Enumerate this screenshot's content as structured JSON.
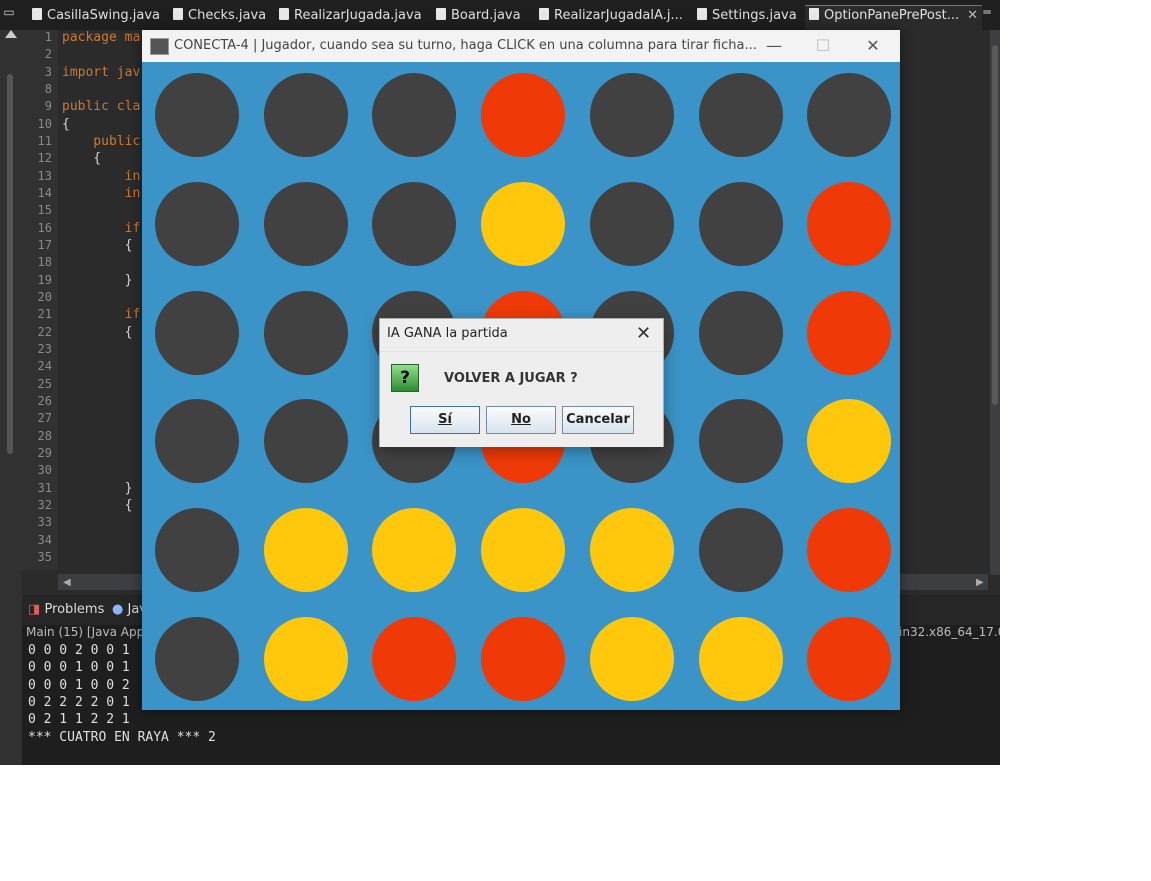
{
  "ide": {
    "editor_tabs": [
      {
        "label": "CasillaSwing.java"
      },
      {
        "label": "Checks.java"
      },
      {
        "label": "RealizarJugada.java"
      },
      {
        "label": "Board.java"
      },
      {
        "label": "RealizarJugadaIA.j..."
      },
      {
        "label": "Settings.java"
      },
      {
        "label": "OptionPanePrePost..."
      }
    ],
    "line_numbers": [
      "1",
      "2",
      "3",
      "8",
      "9",
      "10",
      "11",
      "12",
      "13",
      "14",
      "15",
      "16",
      "17",
      "18",
      "19",
      "20",
      "21",
      "22",
      "23",
      "24",
      "25",
      "26",
      "27",
      "28",
      "29",
      "30",
      "31",
      "32",
      "33",
      "34",
      "35"
    ],
    "code_lines": [
      {
        "text": "package ma"
      },
      {
        "text": "import jav"
      },
      {
        "text": "public cla"
      },
      {
        "text": "{"
      },
      {
        "text": "    public"
      },
      {
        "text": "    {"
      },
      {
        "text": "        in"
      },
      {
        "text": "        in"
      },
      {
        "text": "        if"
      },
      {
        "text": "        {"
      },
      {
        "text": "        }"
      },
      {
        "text": "        if"
      },
      {
        "text": "        {"
      },
      {
        "text": "        }"
      },
      {
        "text": "        {"
      }
    ],
    "bottom_panel": {
      "tabs": [
        "Problems",
        "Jav"
      ],
      "console_header": "Main (15) [Java App",
      "console_header_right": "in32.x86_64_17.0.",
      "console_lines": [
        "0 0 0 2 0 0 1",
        "0 0 0 1 0 0 1",
        "0 0 0 1 0 0 2",
        "0 2 2 2 2 0 1",
        "0 2 1 1 2 2 1",
        "*** CUATRO EN RAYA *** 2"
      ]
    }
  },
  "game_window": {
    "title": "CONECTA-4  | Jugador, cuando sea su turno, haga CLICK en una columna para tirar ficha...",
    "controls": {
      "minimize": "—",
      "maximize": "☐",
      "close": "✕"
    },
    "colors": {
      "empty": "#414141",
      "red": "#ef3a07",
      "yellow": "#ffc80c",
      "board": "#3a94c7"
    },
    "board": [
      [
        0,
        0,
        0,
        1,
        0,
        0,
        0
      ],
      [
        0,
        0,
        0,
        2,
        0,
        0,
        1
      ],
      [
        0,
        0,
        0,
        1,
        0,
        0,
        1
      ],
      [
        0,
        0,
        0,
        1,
        0,
        0,
        2
      ],
      [
        0,
        2,
        2,
        2,
        2,
        0,
        1
      ],
      [
        0,
        2,
        1,
        1,
        2,
        2,
        1
      ]
    ]
  },
  "dialog": {
    "title": "IA GANA la partida",
    "close": "✕",
    "icon": "question-icon",
    "icon_glyph": "?",
    "message": "VOLVER A JUGAR ?",
    "buttons": {
      "yes": "Sí",
      "no": "No",
      "cancel": "Cancelar"
    }
  }
}
